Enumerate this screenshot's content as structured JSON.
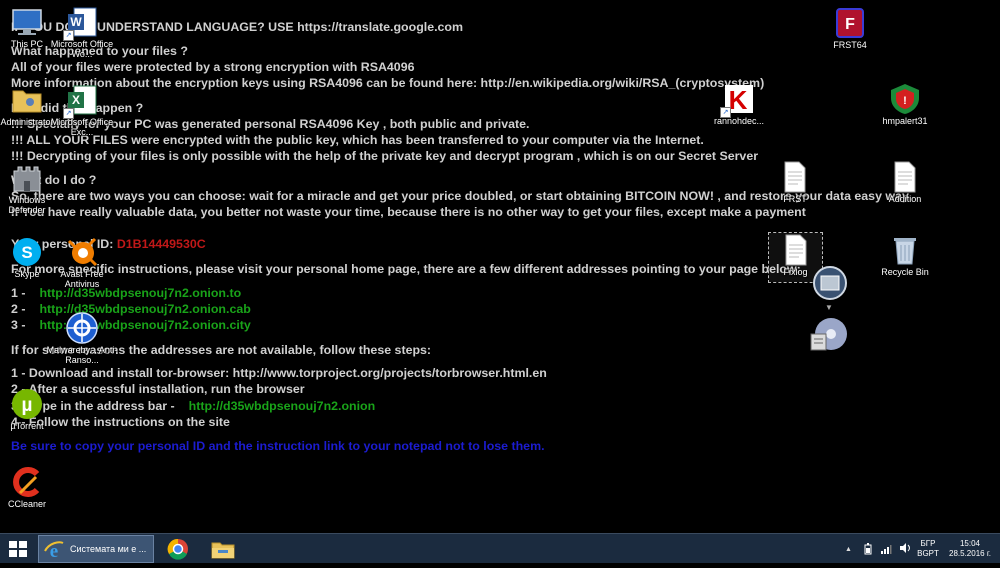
{
  "ransom_note": {
    "lines": [
      {
        "text": "IF YOU DON'T UNDERSTAND LANGUAGE? USE https://translate.google.com"
      },
      {
        "text": "What happened to your files ?"
      },
      {
        "text": "All of your files were protected by a strong encryption with RSA4096"
      },
      {
        "text": "More information about the encryption keys using RSA4096 can be found here: http://en.wikipedia.org/wiki/RSA_(cryptosystem)"
      },
      {
        "text": "How did this happen ?"
      },
      {
        "text": "!!! Specially for your PC was generated personal RSA4096 Key , both public and private."
      },
      {
        "text": "!!! ALL YOUR FILES were encrypted with the public key, which has been transferred to your computer via the Internet."
      },
      {
        "text": "!!! Decrypting of your files is only possible with the help of the private key and decrypt program , which is on our Secret Server"
      },
      {
        "text": "What do I do ?"
      },
      {
        "text": "So, there are two ways you can choose: wait for a miracle and get your price doubled, or start obtaining BITCOIN NOW! , and restore your data easy way"
      },
      {
        "text": "If You have really valuable data, you better not waste your time, because there is no other way to get your files, except make a payment"
      },
      {
        "text": "For more specific instructions, please visit your personal home page, there are a few different addresses pointing to your page below:"
      },
      {
        "text": "If for some reasons the addresses are not available, follow these steps:"
      },
      {
        "text": "1 - Download and install tor-browser: http://www.torproject.org/projects/torbrowser.html.en"
      },
      {
        "text": "2 - After a successful installation, run the browser"
      },
      {
        "text": "4 - Follow the instructions on the site"
      }
    ],
    "personal_id_label": "Your personal ID:",
    "personal_id": "D1B14449530C",
    "link_rows": [
      {
        "num": "1 -",
        "url": "http://d35wbdpsenouj7n2.onion.to"
      },
      {
        "num": "2 -",
        "url": "http://d35wbdpsenouj7n2.onion.cab"
      },
      {
        "num": "3 -",
        "url": "http://d35wbdpsenouj7n2.onion.city"
      }
    ],
    "step3_label": "3 - Type in the address bar -",
    "step3_url": "http://d35wbdpsenouj7n2.onion",
    "warning": "Be sure to copy your personal ID and the instruction link to your notepad not to lose them."
  },
  "desktop_icons": {
    "this_pc": "This PC",
    "word": "Microsoft Office Wo...",
    "admin_folder": "Administrator",
    "excel": "Microsoft Office Exc...",
    "defender": "Windows Defender",
    "skype": "Skype",
    "avast": "Avast Free Antivirus",
    "malwarebytes": "Malwareby... Anti-Ranso...",
    "utorrent": "µTorrent",
    "ccleaner": "CCleaner",
    "frst64": "FRST64",
    "kaspersky": "rannohdec...",
    "hmpalert": "hmpalert31",
    "frst_txt": "FRST",
    "addition": "Addition",
    "fixlog": "Fixlog",
    "recycle_bin": "Recycle Bin"
  },
  "taskbar": {
    "ie_window_title": "Системата ми е ...",
    "lang_1": "БГР",
    "lang_2": "BGPT",
    "time": "15:04",
    "date": "28.5.2016 г."
  },
  "colors": {
    "desktop_background": "#000000",
    "note_text": "#d0d0d0",
    "personal_id": "#c01818",
    "links": "#19a319",
    "warning": "#1c1cd0",
    "taskbar": "#1b2b3f"
  }
}
